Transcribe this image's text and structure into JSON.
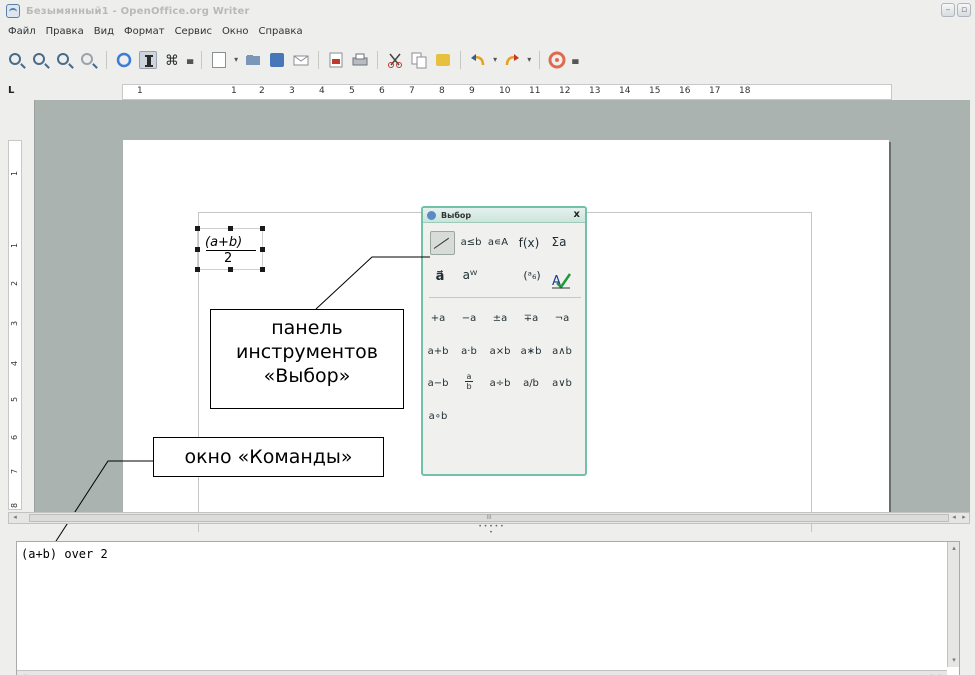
{
  "window": {
    "title": "Безымянный1 - OpenOffice.org Writer",
    "controls": [
      "–",
      "▫"
    ]
  },
  "menu": [
    "Файл",
    "Правка",
    "Вид",
    "Формат",
    "Сервис",
    "Окно",
    "Справка"
  ],
  "toolbar": {
    "icons": [
      "zoom-in-icon",
      "zoom-out-icon",
      "zoom-page-icon",
      "zoom-fit-icon",
      "formula-cursor-icon",
      "elements-toggle-icon",
      "symbols-icon",
      "new-icon",
      "open-icon",
      "save-icon",
      "email-icon",
      "export-pdf-icon",
      "print-icon",
      "cut-icon",
      "copy-icon",
      "paste-icon",
      "undo-icon",
      "redo-icon",
      "help-icon"
    ]
  },
  "ruler": {
    "corner": "L",
    "h_numbers": [
      "1",
      "1",
      "2",
      "3",
      "4",
      "5",
      "6",
      "7",
      "8",
      "9",
      "10",
      "11",
      "12",
      "13",
      "14",
      "15",
      "16",
      "17",
      "18"
    ],
    "v_numbers": [
      "1",
      "1",
      "2",
      "3",
      "4",
      "5",
      "6",
      "7",
      "8"
    ]
  },
  "formula": {
    "numerator": "(a+b)",
    "denominator": "2"
  },
  "elements_panel": {
    "title": "Выбор",
    "close": "x",
    "categories": [
      "a≤b",
      "a∊A",
      "f(x)",
      "Σa",
      "a⃗",
      "aᵂ",
      "(ᵃ₆)"
    ],
    "operators": [
      [
        "+a",
        "−a",
        "±a",
        "∓a",
        "¬a"
      ],
      [
        "a+b",
        "a·b",
        "a×b",
        "a∗b",
        "a∧b"
      ],
      [
        "a−b",
        "a⁄b",
        "a÷b",
        "a/b",
        "a∨b"
      ],
      [
        "a∘b"
      ]
    ],
    "fraction_num": "a",
    "fraction_den": "b"
  },
  "callouts": {
    "elements_label": [
      "панель",
      "инструментов",
      "«Выбор»"
    ],
    "commands_label": "окно «Команды»"
  },
  "commands": {
    "text": "(a+b) over 2"
  },
  "scroll": {
    "thumb": "III"
  }
}
